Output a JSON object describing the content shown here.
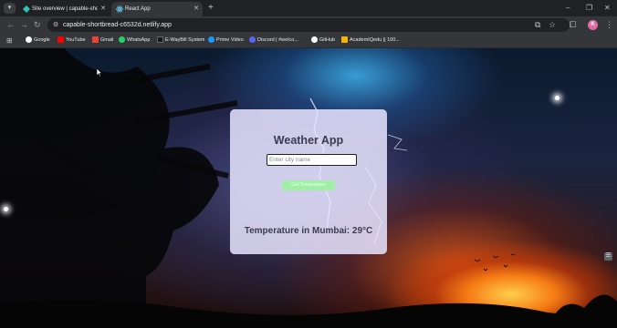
{
  "browser": {
    "tab_menu_glyph": "▾",
    "tabs": [
      {
        "title": "Site overview | capable-shortbr...",
        "favicon_color": "#2bc4b6",
        "active": false
      },
      {
        "title": "React App",
        "favicon_color": "#61dafb",
        "active": true
      }
    ],
    "tab_close_glyph": "✕",
    "new_tab_glyph": "+",
    "window_controls": {
      "minimize": "–",
      "maximize": "❐",
      "close": "✕"
    },
    "nav": {
      "back": "←",
      "forward": "→",
      "reload": "↻"
    },
    "url": "capable-shortbread-c6532d.netlify.app",
    "profile_initial": "K",
    "bookmarks": [
      {
        "label": "Google",
        "color": "#ffffff"
      },
      {
        "label": "YouTube",
        "color": "#ff0000"
      },
      {
        "label": "Gmail",
        "color": "#ea4335"
      },
      {
        "label": "WhatsApp",
        "color": "#25d366"
      },
      {
        "label": "E-WayBill System",
        "color": "#1a1a1a"
      },
      {
        "label": "Prime Video",
        "color": "#1a98ff"
      },
      {
        "label": "Discord | #welco...",
        "color": "#5865f2"
      },
      {
        "label": "GitHub",
        "color": "#ffffff"
      },
      {
        "label": "AcademIQedu || 100...",
        "color": "#f4b400"
      }
    ]
  },
  "app": {
    "title": "Weather App",
    "input_placeholder": "Enter city name",
    "search_button": "Get Temperature",
    "result_text": "Temperature in Mumbai: 29°C"
  }
}
